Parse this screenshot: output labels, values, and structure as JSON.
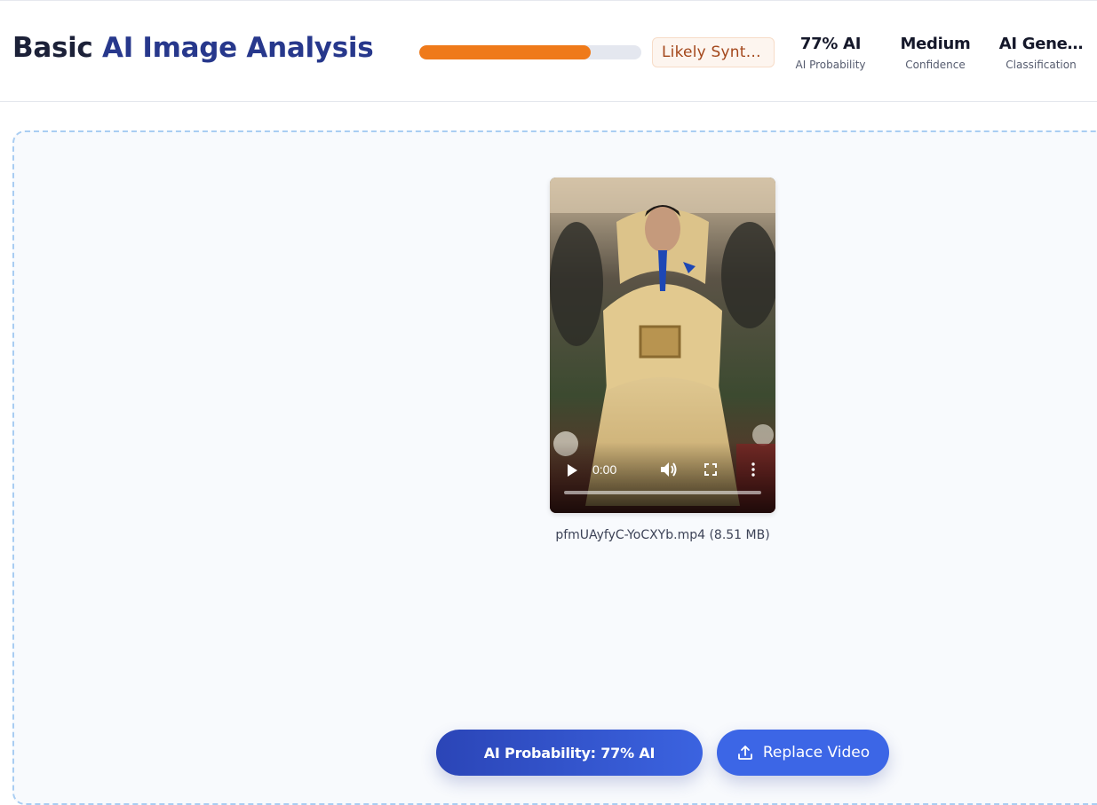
{
  "header": {
    "title_part1": "Basic",
    "title_part2": "AI Image",
    "title_part3": "Analysis",
    "progress_fraction": 0.77,
    "verdict": "Likely Synthe…",
    "stats": {
      "probability_value": "77% AI",
      "probability_label": "AI Probability",
      "confidence_value": "Medium",
      "confidence_label": "Confidence",
      "classification_value": "AI Gene…",
      "classification_label": "Classification"
    }
  },
  "video": {
    "current_time": "0:00",
    "file_caption": "pfmUAyfyC-YoCXYb.mp4 (8.51 MB)"
  },
  "actions": {
    "probability_button": "AI Probability: 77% AI",
    "replace_button": "Replace Video"
  },
  "colors": {
    "progress": "#ef7a1a",
    "primary": "#3c66e6",
    "dropzone_border": "#a9cdf2"
  },
  "icons": [
    "play-icon",
    "volume-icon",
    "fullscreen-icon",
    "more-options-icon",
    "upload-icon"
  ]
}
